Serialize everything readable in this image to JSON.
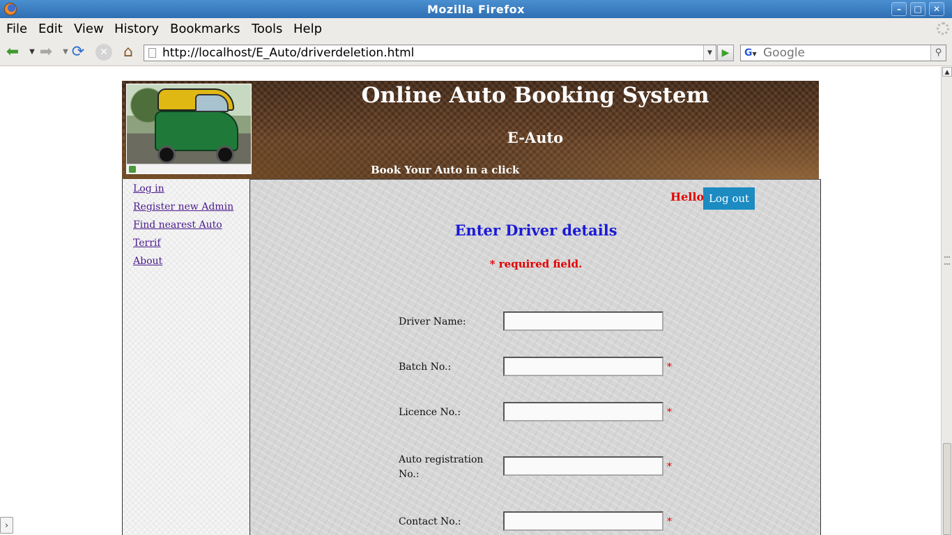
{
  "window": {
    "title": "Mozilla Firefox"
  },
  "menu": [
    "File",
    "Edit",
    "View",
    "History",
    "Bookmarks",
    "Tools",
    "Help"
  ],
  "toolbar": {
    "url": "http://localhost/E_Auto/driverdeletion.html",
    "search_placeholder": "Google",
    "search_engine": "G"
  },
  "site": {
    "title": "Online Auto Booking System",
    "subtitle": "E-Auto",
    "tagline": "Book Your Auto in a click"
  },
  "nav": [
    "Log in",
    "Register new Admin",
    "Find nearest Auto",
    "Terrif",
    "About"
  ],
  "header": {
    "greeting": "Hello,",
    "logout_label": "Log out"
  },
  "form": {
    "title": "Enter Driver details",
    "required_note": "* required field.",
    "required_mark": "*",
    "fields": [
      {
        "label": "Driver Name:",
        "value": "",
        "required": false
      },
      {
        "label": "Batch No.:",
        "value": "",
        "required": true
      },
      {
        "label": "Licence No.:",
        "value": "",
        "required": true
      },
      {
        "label": "Auto registration No.:",
        "value": "",
        "required": true
      },
      {
        "label": "Contact No.:",
        "value": "",
        "required": true
      }
    ]
  }
}
